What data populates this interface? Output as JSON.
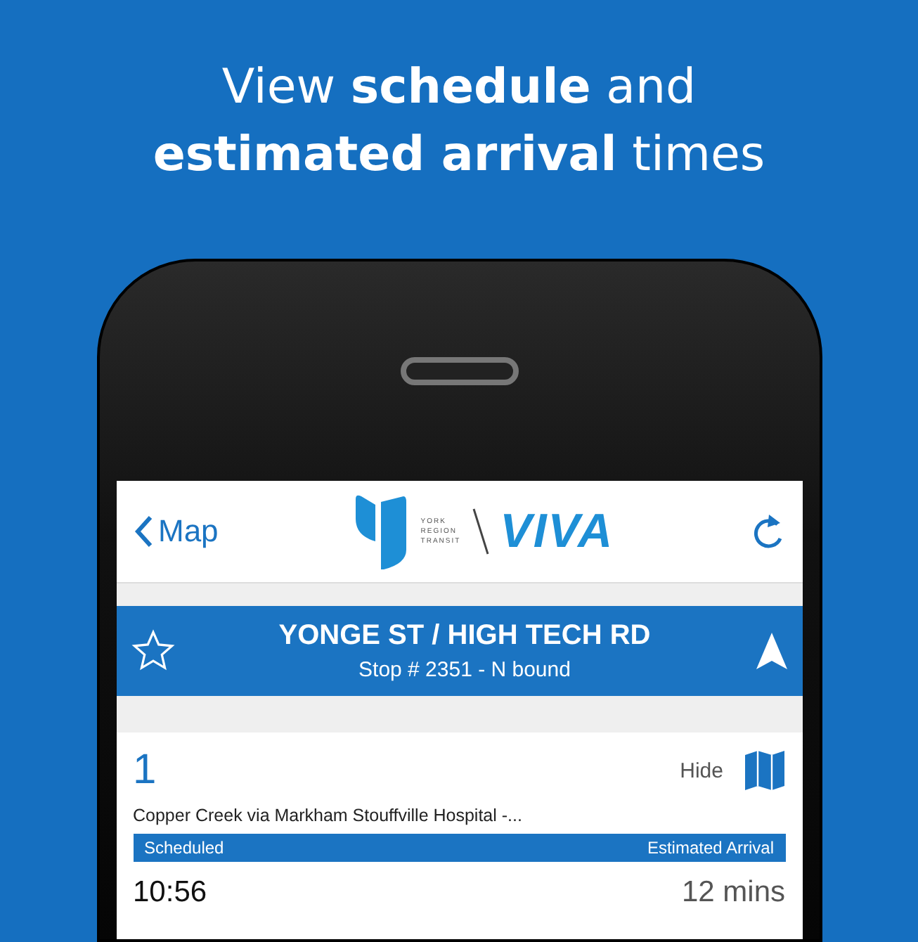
{
  "headline": [
    "View **schedule** and",
    "**estimated arrival** times"
  ],
  "nav": {
    "back_label": "Map",
    "logo": {
      "small_lines": [
        "YORK",
        "REGION",
        "TRANSIT"
      ],
      "wordmark": "VIVA"
    }
  },
  "stop": {
    "name": "YONGE ST / HIGH TECH RD",
    "detail": "Stop # 2351 - N bound",
    "favorite": false
  },
  "route": {
    "number": "1",
    "hide_label": "Hide",
    "destination": "Copper Creek via Markham Stouffville Hospital -...",
    "columns": [
      "Scheduled",
      "Estimated Arrival"
    ],
    "arrivals": [
      {
        "scheduled": "10:56",
        "estimate": "12 mins"
      }
    ]
  }
}
